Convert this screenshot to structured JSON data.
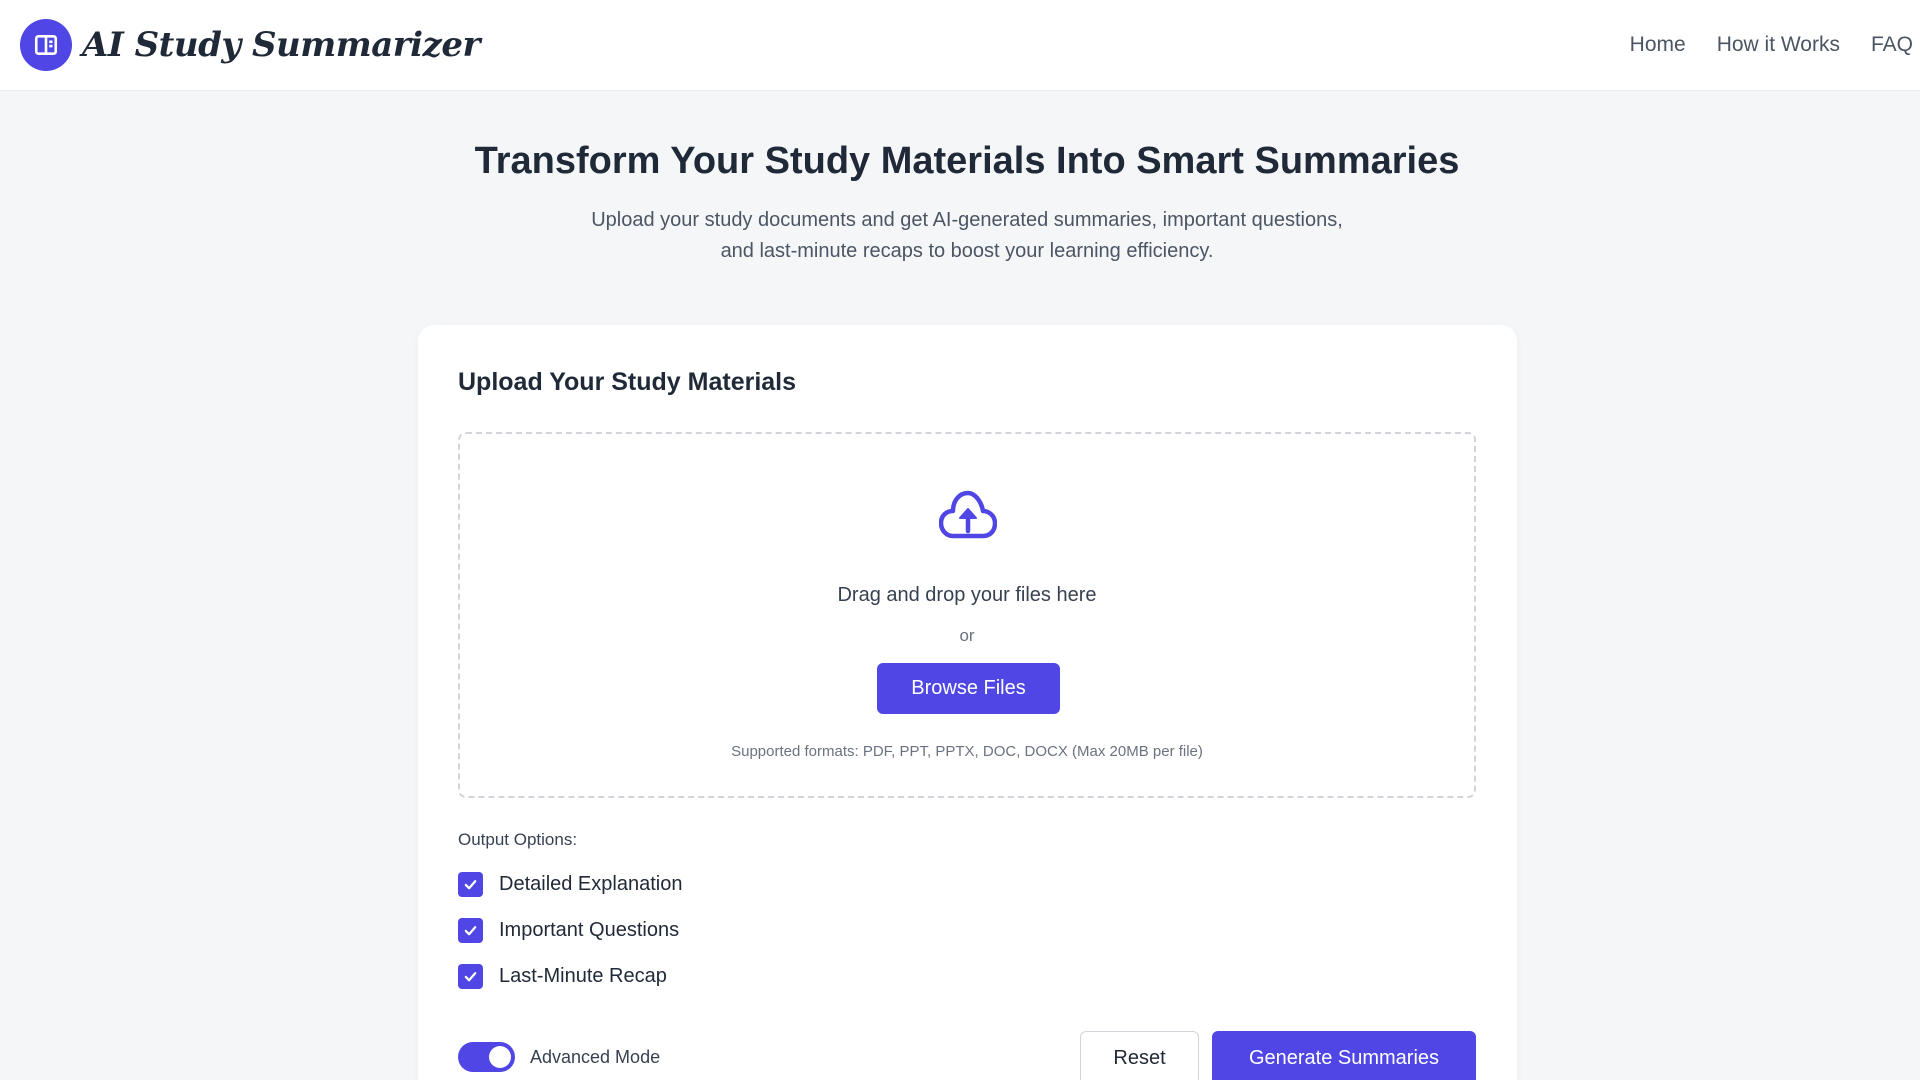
{
  "app": {
    "title": "AI Study Summarizer",
    "logo_icon": "book-open-icon",
    "accent_color": "#4f46e5"
  },
  "nav": {
    "items": [
      {
        "label": "Home"
      },
      {
        "label": "How it Works"
      },
      {
        "label": "FAQ"
      }
    ]
  },
  "hero": {
    "title": "Transform Your Study Materials Into Smart Summaries",
    "subtitle_line1": "Upload your study documents and get AI-generated summaries, important questions,",
    "subtitle_line2": "and last-minute recaps to boost your learning efficiency."
  },
  "upload": {
    "title": "Upload Your Study Materials",
    "icon": "cloud-upload-icon",
    "drop_text": "Drag and drop your files here",
    "or_text": "or",
    "browse_label": "Browse Files",
    "formats_text": "Supported formats: PDF, PPT, PPTX, DOC, DOCX (Max 20MB per file)"
  },
  "options": {
    "label": "Output Options:",
    "items": [
      {
        "label": "Detailed Explanation",
        "checked": true
      },
      {
        "label": "Important Questions",
        "checked": true
      },
      {
        "label": "Last-Minute Recap",
        "checked": true
      }
    ]
  },
  "advanced": {
    "label": "Advanced Mode",
    "enabled": true
  },
  "actions": {
    "reset_label": "Reset",
    "generate_label": "Generate Summaries"
  }
}
